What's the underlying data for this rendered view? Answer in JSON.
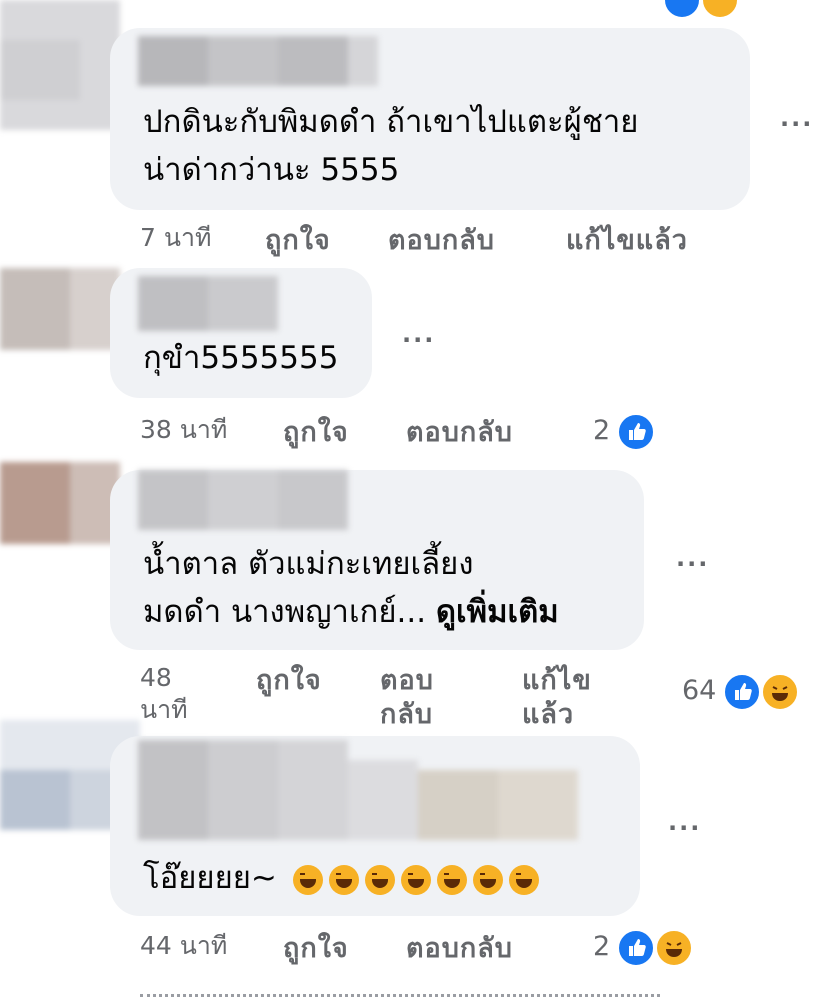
{
  "comments": [
    {
      "text_lines": [
        "ปกดินะกับพิมดดำ ถ้าเขาไปแตะผู้ชาย",
        "น่าด่ากว่านะ 5555"
      ],
      "time": "7 นาที",
      "like": "ถูกใจ",
      "reply": "ตอบกลับ",
      "edited": "แก้ไขแล้ว"
    },
    {
      "text_lines": [
        "กุขำ5555555"
      ],
      "time": "38 นาที",
      "like": "ถูกใจ",
      "reply": "ตอบกลับ",
      "reaction_count": "2",
      "reactions": [
        "like"
      ]
    },
    {
      "text_lines": [
        "น้ำตาล ตัวแม่กะเทยเลี้ยง",
        "มดดำ นางพญาเกย์..."
      ],
      "see_more": "ดูเพิ่มเติม",
      "time_lines": [
        "48",
        "นาที"
      ],
      "like": "ถูกใจ",
      "reply_lines": [
        "ตอบ",
        "กลับ"
      ],
      "edited_lines": [
        "แก้ไข",
        "แล้ว"
      ],
      "reaction_count": "64",
      "reactions": [
        "like",
        "haha"
      ]
    },
    {
      "text_lines": [
        "โอ๊ยยยย~"
      ],
      "emoji_count": 7,
      "time": "44 นาที",
      "like": "ถูกใจ",
      "reply": "ตอบกลับ",
      "reaction_count": "2",
      "reactions": [
        "like",
        "haha"
      ]
    }
  ],
  "more_label": "···",
  "colors": {
    "bubble": "#f0f2f5",
    "secondary_text": "#65676b",
    "like_blue": "#1877f2",
    "haha_yellow": "#f7b125"
  }
}
